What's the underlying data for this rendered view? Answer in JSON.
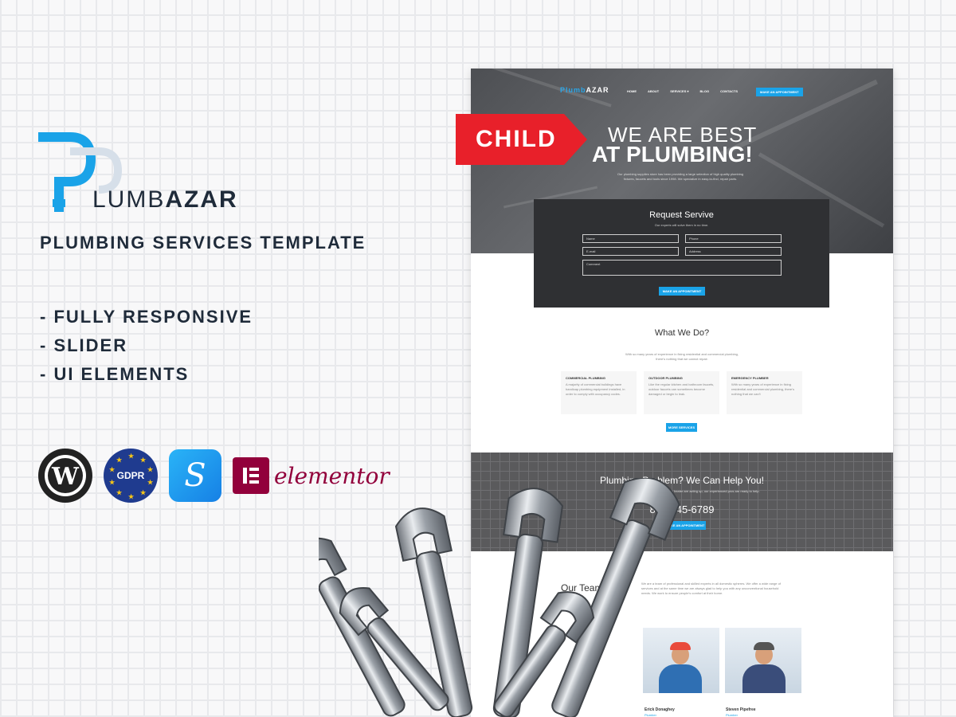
{
  "brand": {
    "name_part1": "LUMB",
    "name_part2": "AZAR",
    "tagline": "PLUMBING SERVICES TEMPLATE"
  },
  "features": [
    "- FULLY RESPONSIVE",
    "- SLIDER",
    "- UI ELEMENTS"
  ],
  "badges": {
    "gdpr": "GDPR",
    "elementor": "elementor"
  },
  "child_tag": "CHILD",
  "preview": {
    "logo_part1": "Plumb",
    "logo_part2": "AZAR",
    "nav": [
      "HOME",
      "ABOUT",
      "SERVICES ▾",
      "BLOG",
      "CONTACTS"
    ],
    "nav_button": "MAKE AN APPOINTMENT",
    "hero_line1": "WE ARE BEST",
    "hero_line2": "AT PLUMBING!",
    "hero_sub": "Our plumbing supplies store has been providing a large selection of high quality plumbing fixtures, faucets and tools since 1998. We specialize in easy-to-find, repair parts.",
    "form": {
      "title": "Request Servive",
      "subtitle": "Our experts will solve them in no time.",
      "name": "Name",
      "phone": "Phone",
      "email": "E-mail",
      "address": "Address",
      "comment": "Comment",
      "button": "MAKE AN APPOINTMENT"
    },
    "what_we_do": {
      "title": "What We Do?",
      "subtitle": "With so many years of experience in fixing residential and commercial plumbing, there's nothing that we cannot repair.",
      "services": [
        {
          "title": "COMMERCIAL PLUMBING",
          "text": "A majority of commercial buildings have handicap plumbing equipment installed, in order to comply with occupancy codes."
        },
        {
          "title": "OUTDOOR PLUMBING",
          "text": "Like the regular kitchen and bathroom faucets, outdoor faucets can sometimes become damaged or begin to leak."
        },
        {
          "title": "EMERGENCY PLUMBER",
          "text": "With so many years of experience in fixing residential and commercial plumbing, there's nothing that we can't"
        }
      ],
      "button": "MORE SERVICES"
    },
    "cta": {
      "title": "Plumbing Problem? We Can Help You!",
      "sub": "If your drains, toilets, faucets or water heater are acting up, our experienced pros are ready to help.",
      "phone": "800-345-6789",
      "button": "MAKE AN APPOINTMENT"
    },
    "team": {
      "title": "Our Team",
      "text": "We are a team of professional and skilled experts in all domestic spheres. We offer a wide range of services and at the same time we are always glad to help you with any unconventional household needs. We work to ensure people's comfort at their home.",
      "members": [
        {
          "name": "Erick Donaghey",
          "role": "Plumber"
        },
        {
          "name": "Steven Pipefree",
          "role": "Plumber"
        }
      ]
    }
  },
  "colors": {
    "accent": "#1aa3e8",
    "dark": "#1f2b3a",
    "child_red": "#e8202a",
    "elementor": "#92003b"
  }
}
